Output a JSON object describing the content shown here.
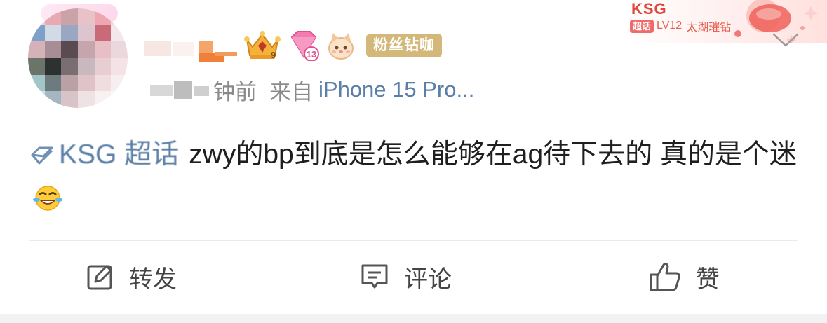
{
  "post": {
    "meta": {
      "time_suffix": "钟前",
      "from_label": "来自",
      "device": "iPhone 15 Pro..."
    },
    "badges": {
      "crown_level": "9",
      "diamond_level": "13",
      "fan_tag": "粉丝钻咖"
    },
    "fan_card": {
      "title": "KSG",
      "tag": "超话",
      "level": "LV12",
      "rank_name": "太湖璀钻"
    },
    "content": {
      "topic": "KSG 超话",
      "text": "zwy的bp到底是怎么能够在ag待下去的 真的是个迷",
      "emoji_icon": "laugh-cry-emoji"
    },
    "actions": {
      "repost_label": "转发",
      "comment_label": "评论",
      "like_label": "赞"
    }
  },
  "colors": {
    "link_blue": "#5b7fa6",
    "meta_gray": "#8a8a8a",
    "fan_tag_gold": "#d3b87a",
    "fan_card_red": "#e0453a"
  }
}
